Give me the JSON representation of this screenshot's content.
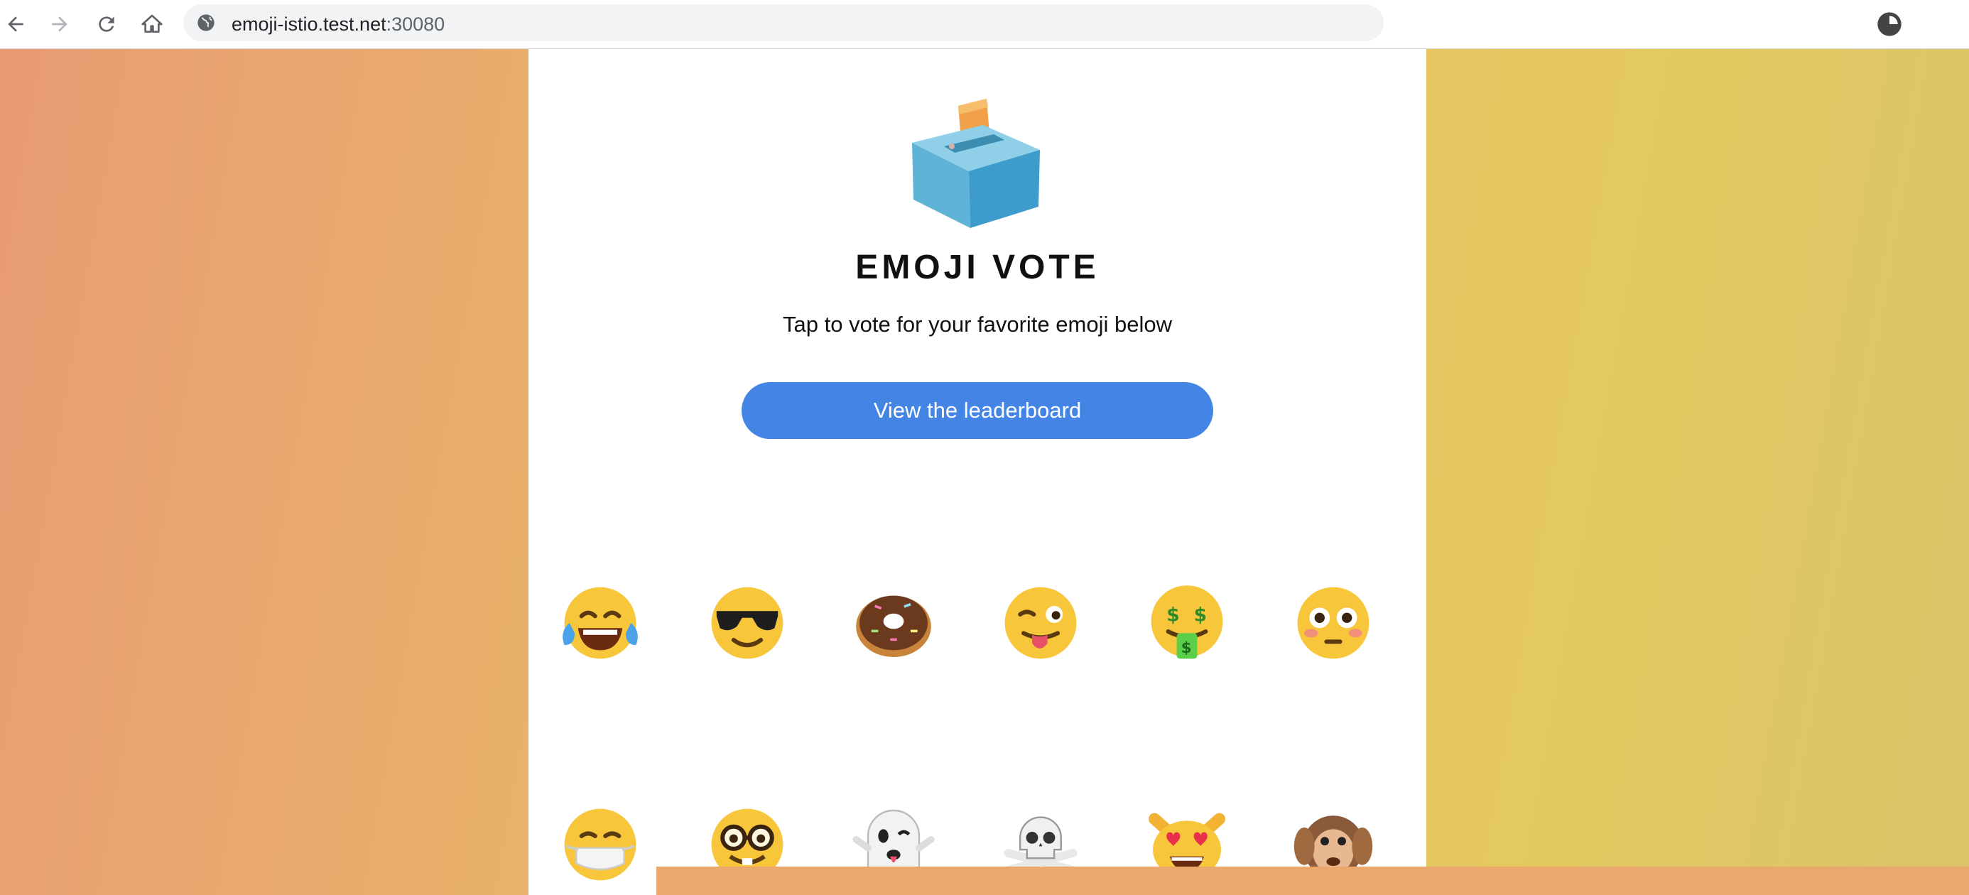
{
  "browser": {
    "url_host": "emoji-istio.test.net",
    "url_port": ":30080",
    "nav_icons": [
      "back-arrow-icon",
      "forward-arrow-icon",
      "reload-icon",
      "home-icon"
    ],
    "site_icon": "globe-icon"
  },
  "page": {
    "logo_icon": "ballot-box-icon",
    "title": "EMOJI VOTE",
    "subtitle": "Tap to vote for your favorite emoji below",
    "leaderboard_button": "View the leaderboard",
    "colors": {
      "button": "#4384e5",
      "background_left": "#e99b74",
      "background_right": "#e9c463"
    }
  },
  "emojis": [
    {
      "name": "face-with-tears-of-joy"
    },
    {
      "name": "smiling-face-with-sunglasses"
    },
    {
      "name": "doughnut"
    },
    {
      "name": "winking-face-with-tongue"
    },
    {
      "name": "money-mouth-face"
    },
    {
      "name": "flushed-face"
    },
    {
      "name": "face-with-medical-mask"
    },
    {
      "name": "nerd-face"
    },
    {
      "name": "ghost"
    },
    {
      "name": "skull-and-crossbones"
    },
    {
      "name": "smiling-cat-with-heart-eyes"
    },
    {
      "name": "hear-no-evil-monkey"
    }
  ]
}
